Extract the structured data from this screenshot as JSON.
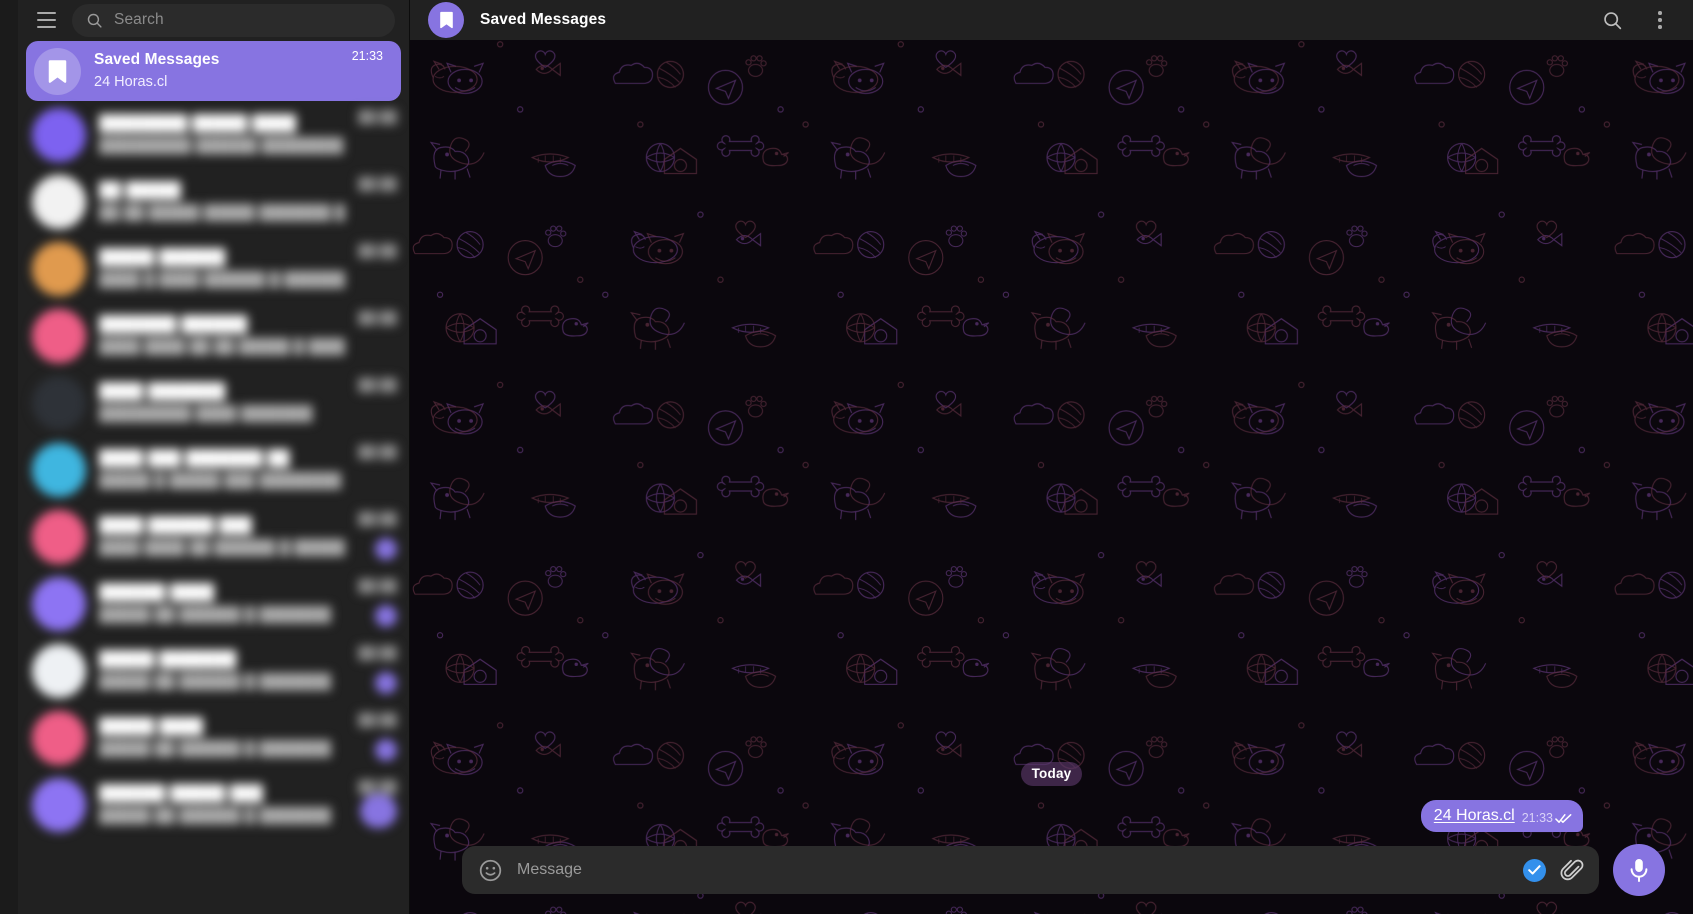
{
  "colors": {
    "accent": "#8774e1",
    "panel": "#212121",
    "rail": "#1b1b1b",
    "wallpaper": "#0b070d",
    "wallpaper_doodle": "#3a2250",
    "blue_check": "#3390ec",
    "text_primary": "#ffffff",
    "text_secondary": "#aaaaaa"
  },
  "sidebar": {
    "menu_button": "menu-icon",
    "search": {
      "placeholder": "Search",
      "value": "",
      "icon": "search-icon"
    },
    "chats": [
      {
        "title": "Saved Messages",
        "subtitle": "24 Horas.cl",
        "time": "21:33",
        "badge": "",
        "selected": true,
        "blurred": false,
        "avatar_icon": "bookmark-icon",
        "avatar_color": "#a896ea"
      },
      {
        "title": "████████ █████ ████",
        "subtitle": "█████████ ██████ ████████ █ ███████",
        "time": "██:██",
        "badge": "",
        "selected": false,
        "blurred": true,
        "avatar_icon": "",
        "avatar_color": "#7d62f0"
      },
      {
        "title": "██ █████",
        "subtitle": "██ ██ █████ █████ ███████ ████████",
        "time": "██:██",
        "badge": "",
        "selected": false,
        "blurred": true,
        "avatar_icon": "",
        "avatar_color": "#f2f2f2"
      },
      {
        "title": "█████ ██████",
        "subtitle": "████ █ ████ ██████ █ ███████",
        "time": "██:██",
        "badge": "",
        "selected": false,
        "blurred": true,
        "avatar_icon": "",
        "avatar_color": "#e09a4e"
      },
      {
        "title": "███████ ██████",
        "subtitle": "████ ████ ██ ██ █████ █ ███████",
        "time": "██:██",
        "badge": "",
        "selected": false,
        "blurred": true,
        "avatar_icon": "",
        "avatar_color": "#ef5e87"
      },
      {
        "title": "████ ███████",
        "subtitle": "█████████ ████ ███████",
        "time": "██:██",
        "badge": "",
        "selected": false,
        "blurred": true,
        "avatar_icon": "",
        "avatar_color": "#2e3238"
      },
      {
        "title": "████ ███ ███████ ██",
        "subtitle": "█████ █ █████ ███ ████████ ███████",
        "time": "██:██",
        "badge": "",
        "selected": false,
        "blurred": true,
        "avatar_icon": "",
        "avatar_color": "#3fb6e0"
      },
      {
        "title": "████ ██████ ███",
        "subtitle": "████ ████ ██ ██████ █ ███████",
        "time": "██:██",
        "badge": " ",
        "selected": false,
        "blurred": true,
        "avatar_icon": "",
        "avatar_color": "#ef5e87"
      },
      {
        "title": "██████ ████",
        "subtitle": "█████ ██ ██████ █ ███████",
        "time": "██:██",
        "badge": " ",
        "selected": false,
        "blurred": true,
        "avatar_icon": "",
        "avatar_color": "#8d74f3"
      },
      {
        "title": "█████ ███████",
        "subtitle": "█████ ██ ██████ █ ███████",
        "time": "██:██",
        "badge": " ",
        "selected": false,
        "blurred": true,
        "avatar_icon": "",
        "avatar_color": "#eef1f4"
      },
      {
        "title": "█████ ████",
        "subtitle": "█████ ██ ██████ █ ███████",
        "time": "██:██",
        "badge": " ",
        "selected": false,
        "blurred": true,
        "avatar_icon": "",
        "avatar_color": "#ef5e87"
      },
      {
        "title": "██████ █████ ███",
        "subtitle": "█████ ██ ██████ █ ███████",
        "time": "██:██",
        "badge": "  ",
        "badge_big": true,
        "selected": false,
        "blurred": true,
        "avatar_icon": "",
        "avatar_color": "#8d74f3"
      }
    ]
  },
  "chat": {
    "header": {
      "title": "Saved Messages",
      "avatar_icon": "bookmark-icon",
      "search_icon": "search-icon",
      "menu_icon": "more-vertical-icon"
    },
    "day_divider": "Today",
    "messages": [
      {
        "text": "24 Horas.cl",
        "time": "21:33",
        "status": "read",
        "outgoing": true,
        "is_link": true
      }
    ],
    "composer": {
      "emoji_icon": "smiley-icon",
      "placeholder": "Message",
      "value": "",
      "verified_icon": "blue-check-icon",
      "attach_icon": "paperclip-icon",
      "record_icon": "microphone-icon"
    }
  }
}
